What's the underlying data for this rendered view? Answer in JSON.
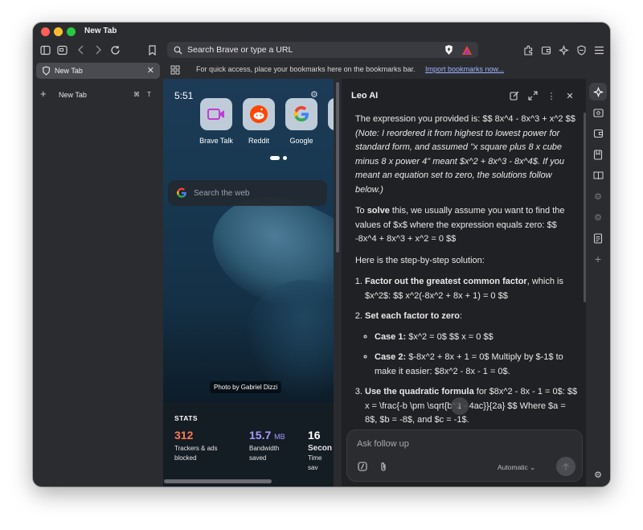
{
  "window": {
    "title": "New Tab"
  },
  "toolbar": {
    "url_placeholder": "Search Brave or type a URL"
  },
  "bookmarks_bar": {
    "hint": "For quick access, place your bookmarks here on the bookmarks bar.",
    "import_link": "Import bookmarks now..."
  },
  "sidebar": {
    "active_tab": "New Tab",
    "new_tab_label": "New Tab",
    "shortcut_keys": [
      "⌘",
      "T"
    ]
  },
  "ntp": {
    "time": "5:51",
    "tiles": [
      {
        "label": "Brave Talk"
      },
      {
        "label": "Reddit"
      },
      {
        "label": "Google"
      }
    ],
    "search_placeholder": "Search the web",
    "photo_credit": "Photo by Gabriel Dizzi",
    "stats": {
      "title": "STATS",
      "trackers": {
        "value": "312",
        "label_line1": "Trackers & ads",
        "label_line2": "blocked",
        "color": "#ff7a52"
      },
      "bandwidth": {
        "value": "15.7",
        "unit": "MB",
        "label_line1": "Bandwidth",
        "label_line2": "saved",
        "color": "#a79bff"
      },
      "time": {
        "value": "16",
        "label_line1": "Secon",
        "label_line2": "Time sav",
        "color": "#ffffff"
      }
    }
  },
  "leo": {
    "title": "Leo AI",
    "intro_plain": "The expression you provided is: $$ 8x^4 - 8x^3 + x^2 $$ ",
    "intro_note": "(Note: I reordered it from highest to lowest power for standard form, and assumed \"x square plus 8 x cube minus 8 x power 4\" meant $x^2 + 8x^3 - 8x^4$. If you meant an equation set to zero, the solutions follow below.)",
    "solve_bold": "solve",
    "solve_prefix": "To ",
    "solve_rest": " this, we usually assume you want to find the values of $x$ where the expression equals zero: $$ -8x^4 + 8x^3 + x^2 = 0 $$",
    "steps_intro": "Here is the step-by-step solution:",
    "step1_bold": "Factor out the greatest common factor",
    "step1_rest": ", which is $x^2$: $$ x^2(-8x^2 + 8x + 1) = 0 $$",
    "step2_bold": "Set each factor to zero",
    "step2_rest": ":",
    "case1_bold": "Case 1:",
    "case1_rest": " $x^2 = 0$ $$ x = 0 $$",
    "case2_bold": "Case 2:",
    "case2_rest": " $-8x^2 + 8x + 1 = 0$ Multiply by $-1$ to make it easier: $8x^2 - 8x - 1 = 0$.",
    "step3_bold": "Use the quadratic formula",
    "step3_rest": " for $8x^2 - 8x - 1 = 0$: $$ x = \\frac{-b \\pm \\sqrt{b^2 - 4ac}}{2a} $$ Where $a = 8$, $b = -8$, and $c = -1$.",
    "input_placeholder": "Ask follow up",
    "model": "Automatic"
  }
}
